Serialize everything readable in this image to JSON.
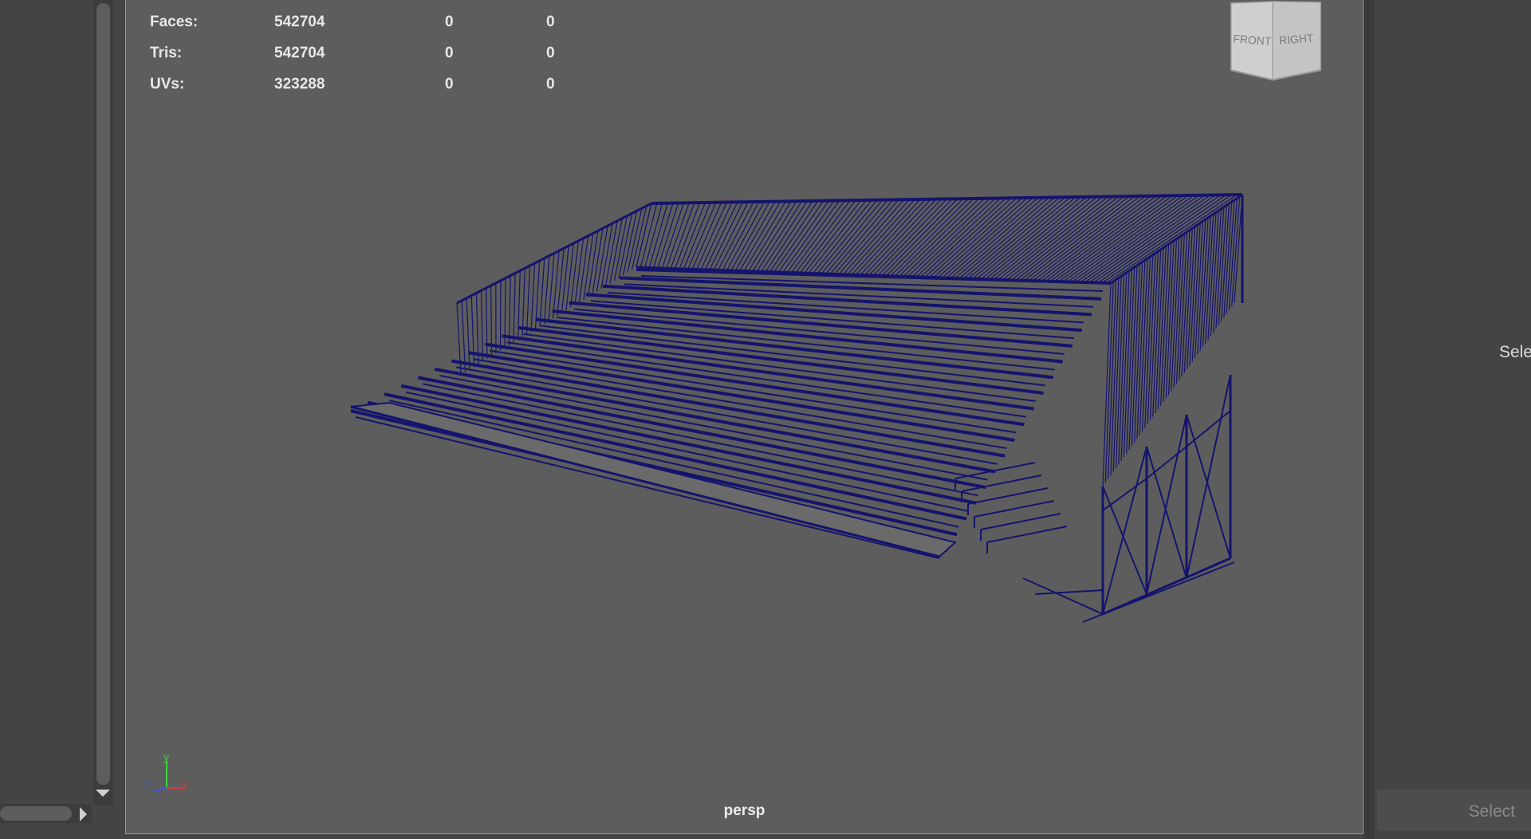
{
  "hud": {
    "rows": [
      {
        "label": "Faces:",
        "v1": "542704",
        "v2": "0",
        "v3": "0"
      },
      {
        "label": "Tris:",
        "v1": "542704",
        "v2": "0",
        "v3": "0"
      },
      {
        "label": "UVs:",
        "v1": "323288",
        "v2": "0",
        "v3": "0"
      }
    ]
  },
  "view_cube": {
    "front": "FRONT",
    "right": "RIGHT"
  },
  "viewport": {
    "camera": "persp",
    "wireframe_color": "#14146e",
    "background": "#5d5d5d"
  },
  "axis_gizmo": {
    "x": "x",
    "y": "y",
    "z": "z",
    "x_color": "#d43a3a",
    "y_color": "#3ad43a",
    "z_color": "#3a5ad4"
  },
  "right_panel": {
    "select_label": "Sele",
    "select_button": "Select"
  },
  "icons": [
    "scroll-down-arrow-icon",
    "scroll-right-arrow-icon",
    "view-cube-icon",
    "axis-gizmo-icon"
  ]
}
